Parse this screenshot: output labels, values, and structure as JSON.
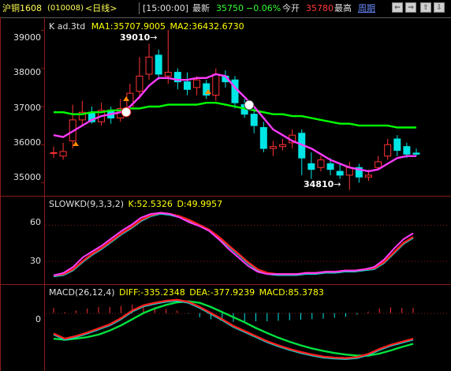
{
  "header": {
    "symbol": "沪铜1608",
    "code": "(010008)",
    "period": "<日线>",
    "time": "[15:00:00]",
    "latest_label": "最新",
    "latest_value": "35750",
    "change_pct": "−0.06%",
    "open_label": "今开",
    "open_value": "35780",
    "high_label": "最高",
    "cycle_label": "周期"
  },
  "chart_data": [
    {
      "type": "candlestick",
      "title": "K  ad.3td",
      "ma1_label": "MA1:35707.9005",
      "ma2_label": "MA2:36432.6730",
      "y_ticks": [
        "39000",
        "38000",
        "37000",
        "36000",
        "35000"
      ],
      "ylim": [
        34700,
        39300
      ],
      "high_annotation": "39010",
      "low_annotation": "34810",
      "candles": [
        {
          "o": 35780,
          "c": 35790,
          "h": 35950,
          "l": 35650
        },
        {
          "o": 35700,
          "c": 35820,
          "h": 36050,
          "l": 35600
        },
        {
          "o": 36100,
          "c": 36650,
          "h": 37050,
          "l": 35900
        },
        {
          "o": 36650,
          "c": 36850,
          "h": 37150,
          "l": 36500
        },
        {
          "o": 36850,
          "c": 36600,
          "h": 37000,
          "l": 36550
        },
        {
          "o": 36600,
          "c": 36900,
          "h": 37100,
          "l": 36500
        },
        {
          "o": 36900,
          "c": 36700,
          "h": 37000,
          "l": 36550
        },
        {
          "o": 36700,
          "c": 36950,
          "h": 37200,
          "l": 36600
        },
        {
          "o": 36950,
          "c": 37350,
          "h": 37600,
          "l": 36800
        },
        {
          "o": 37400,
          "c": 37800,
          "h": 38300,
          "l": 37200
        },
        {
          "o": 37850,
          "c": 38300,
          "h": 38650,
          "l": 37700
        },
        {
          "o": 38350,
          "c": 37850,
          "h": 38500,
          "l": 37700
        },
        {
          "o": 37800,
          "c": 37900,
          "h": 39010,
          "l": 37600
        },
        {
          "o": 37900,
          "c": 37650,
          "h": 38000,
          "l": 37450
        },
        {
          "o": 37650,
          "c": 37450,
          "h": 37900,
          "l": 37300
        },
        {
          "o": 37500,
          "c": 37700,
          "h": 37800,
          "l": 37300
        },
        {
          "o": 37600,
          "c": 37300,
          "h": 37700,
          "l": 37200
        },
        {
          "o": 37300,
          "c": 37850,
          "h": 38000,
          "l": 37150
        },
        {
          "o": 37800,
          "c": 37650,
          "h": 37950,
          "l": 37500
        },
        {
          "o": 37700,
          "c": 37100,
          "h": 37800,
          "l": 36950
        },
        {
          "o": 37050,
          "c": 36800,
          "h": 37200,
          "l": 36700
        },
        {
          "o": 36800,
          "c": 36500,
          "h": 36950,
          "l": 36300
        },
        {
          "o": 36450,
          "c": 35900,
          "h": 36600,
          "l": 35800
        },
        {
          "o": 35900,
          "c": 35950,
          "h": 36100,
          "l": 35700
        },
        {
          "o": 35950,
          "c": 36000,
          "h": 36150,
          "l": 35850
        },
        {
          "o": 36050,
          "c": 36250,
          "h": 36400,
          "l": 35900
        },
        {
          "o": 36300,
          "c": 35650,
          "h": 36400,
          "l": 35200
        },
        {
          "o": 35500,
          "c": 35350,
          "h": 35800,
          "l": 35100
        },
        {
          "o": 35400,
          "c": 35600,
          "h": 35700,
          "l": 35300
        },
        {
          "o": 35500,
          "c": 35350,
          "h": 35650,
          "l": 35200
        },
        {
          "o": 35300,
          "c": 35200,
          "h": 35500,
          "l": 35100
        },
        {
          "o": 35200,
          "c": 35400,
          "h": 35550,
          "l": 34810
        },
        {
          "o": 35400,
          "c": 35150,
          "h": 35500,
          "l": 35000
        },
        {
          "o": 35150,
          "c": 35200,
          "h": 35350,
          "l": 35050
        },
        {
          "o": 35400,
          "c": 35550,
          "h": 35700,
          "l": 35350
        },
        {
          "o": 35700,
          "c": 36000,
          "h": 36150,
          "l": 35600
        },
        {
          "o": 36150,
          "c": 35850,
          "h": 36250,
          "l": 35700
        },
        {
          "o": 35950,
          "c": 35750,
          "h": 36050,
          "l": 35650
        },
        {
          "o": 35780,
          "c": 35750,
          "h": 35900,
          "l": 35700
        }
      ],
      "ma1": [
        36250,
        36200,
        36350,
        36500,
        36650,
        36750,
        36800,
        36850,
        37000,
        37250,
        37550,
        37750,
        37750,
        37700,
        37700,
        37750,
        37750,
        37850,
        37800,
        37500,
        37250,
        37000,
        36700,
        36400,
        36250,
        36100,
        36000,
        35900,
        35750,
        35600,
        35500,
        35400,
        35350,
        35300,
        35350,
        35500,
        35650,
        35700,
        35700
      ],
      "ma2": [
        36850,
        36850,
        36800,
        36800,
        36850,
        36850,
        36900,
        36900,
        36950,
        36950,
        37000,
        37000,
        37050,
        37050,
        37050,
        37050,
        37100,
        37100,
        37050,
        37000,
        36950,
        36900,
        36850,
        36800,
        36800,
        36750,
        36750,
        36700,
        36650,
        36600,
        36550,
        36550,
        36500,
        36500,
        36500,
        36500,
        36450,
        36450,
        36450
      ]
    },
    {
      "type": "line",
      "title": "SLOWKD(9,3,3,2)",
      "k_label": "K:52.5326",
      "d_label": "D:49.9957",
      "y_ticks": [
        "60",
        "30"
      ],
      "ylim": [
        12,
        75
      ],
      "k": [
        18,
        20,
        25,
        33,
        38,
        43,
        49,
        55,
        60,
        66,
        69,
        70,
        69,
        66,
        62,
        59,
        55,
        48,
        40,
        33,
        26,
        21,
        19,
        19,
        19,
        19,
        20,
        20,
        21,
        21,
        22,
        22,
        23,
        25,
        31,
        40,
        48,
        53
      ],
      "d": [
        18,
        19,
        23,
        30,
        36,
        41,
        47,
        53,
        58,
        64,
        68,
        70,
        69,
        67,
        64,
        60,
        56,
        50,
        43,
        36,
        29,
        23,
        20,
        19,
        19,
        19,
        20,
        20,
        21,
        21,
        22,
        22,
        23,
        24,
        29,
        37,
        45,
        50
      ]
    },
    {
      "type": "line",
      "title": "MACD(26,12,4)",
      "diff_label": "DIFF:-335.2348",
      "dea_label": "DEA:-377.9239",
      "macd_label": "MACD:85.3783",
      "y_ticks": [
        "0"
      ],
      "ylim": [
        -1100,
        380
      ],
      "diff": [
        -400,
        -500,
        -450,
        -380,
        -300,
        -220,
        -100,
        50,
        150,
        200,
        240,
        260,
        220,
        120,
        0,
        -120,
        -250,
        -350,
        -450,
        -550,
        -630,
        -700,
        -760,
        -810,
        -850,
        -870,
        -880,
        -860,
        -800,
        -700,
        -620,
        -560,
        -500
      ],
      "dea": [
        -500,
        -520,
        -500,
        -470,
        -420,
        -340,
        -240,
        -120,
        0,
        90,
        160,
        210,
        230,
        200,
        120,
        20,
        -80,
        -180,
        -290,
        -390,
        -480,
        -560,
        -630,
        -690,
        -740,
        -780,
        -810,
        -830,
        -830,
        -790,
        -730,
        -660,
        -600
      ],
      "macd": [
        100,
        20,
        50,
        90,
        120,
        120,
        140,
        170,
        150,
        110,
        80,
        50,
        -10,
        -80,
        -120,
        -140,
        -170,
        -170,
        -160,
        -160,
        -150,
        -140,
        -130,
        -120,
        -110,
        -90,
        -70,
        -30,
        30,
        90,
        110,
        100,
        100
      ]
    }
  ],
  "colors": {
    "background": "#000000",
    "up": "#ff3232",
    "down": "#00e5e5",
    "ma1": "#ff3cff",
    "ma2": "#00ff00",
    "border": "#8b1a1a",
    "k": "#ff3cff",
    "d": "#ffff00"
  }
}
